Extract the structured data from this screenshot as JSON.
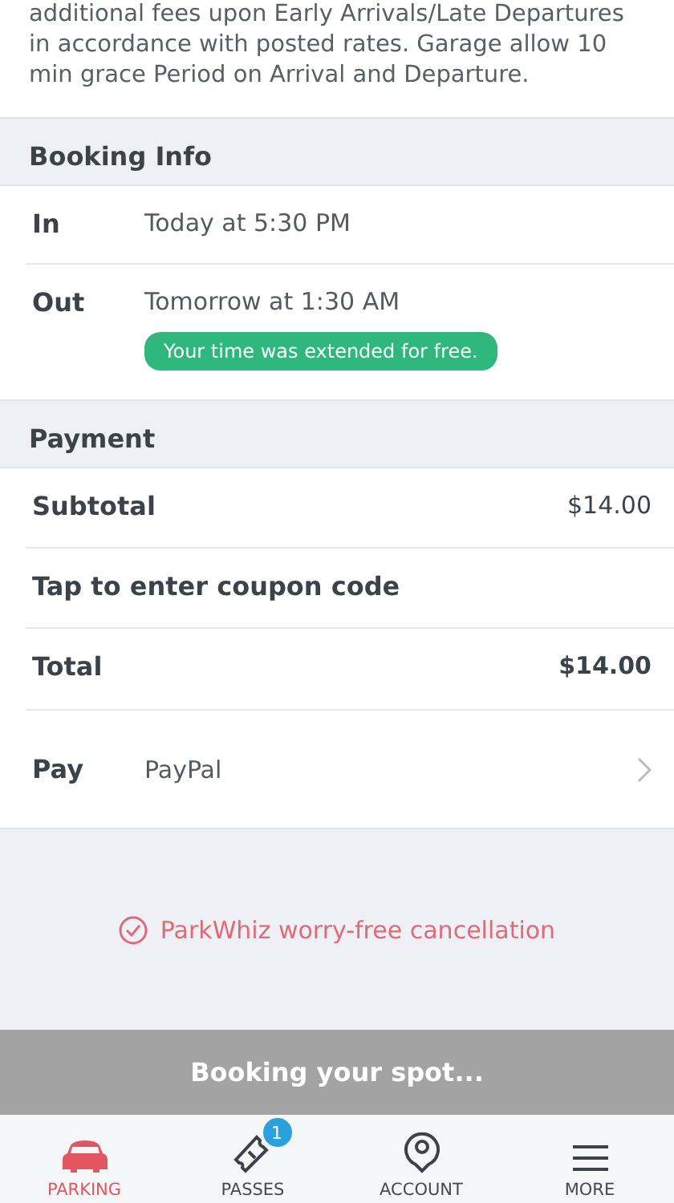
{
  "notice": "additional fees upon Early Arrivals/Late Departures in accordance with posted rates. Garage allow 10 min grace Period on Arrival and Departure.",
  "booking_info": {
    "title": "Booking Info",
    "rows": [
      {
        "label": "In",
        "value": "Today at 5:30 PM"
      },
      {
        "label": "Out",
        "value": "Tomorrow at 1:30 AM",
        "badge": "Your time was extended for free."
      }
    ]
  },
  "payment": {
    "title": "Payment",
    "subtotal": {
      "label": "Subtotal",
      "value": "$14.00"
    },
    "coupon": "Tap to enter coupon code",
    "total": {
      "label": "Total",
      "value": "$14.00"
    },
    "pay": {
      "label": "Pay",
      "value": "PayPal"
    }
  },
  "cancellation": "ParkWhiz worry-free cancellation",
  "booking_button": "Booking your spot...",
  "tabs": [
    {
      "label": "PARKING",
      "selected": true
    },
    {
      "label": "PASSES",
      "selected": false,
      "badge": "1"
    },
    {
      "label": "ACCOUNT",
      "selected": false
    },
    {
      "label": "MORE",
      "selected": false
    }
  ]
}
